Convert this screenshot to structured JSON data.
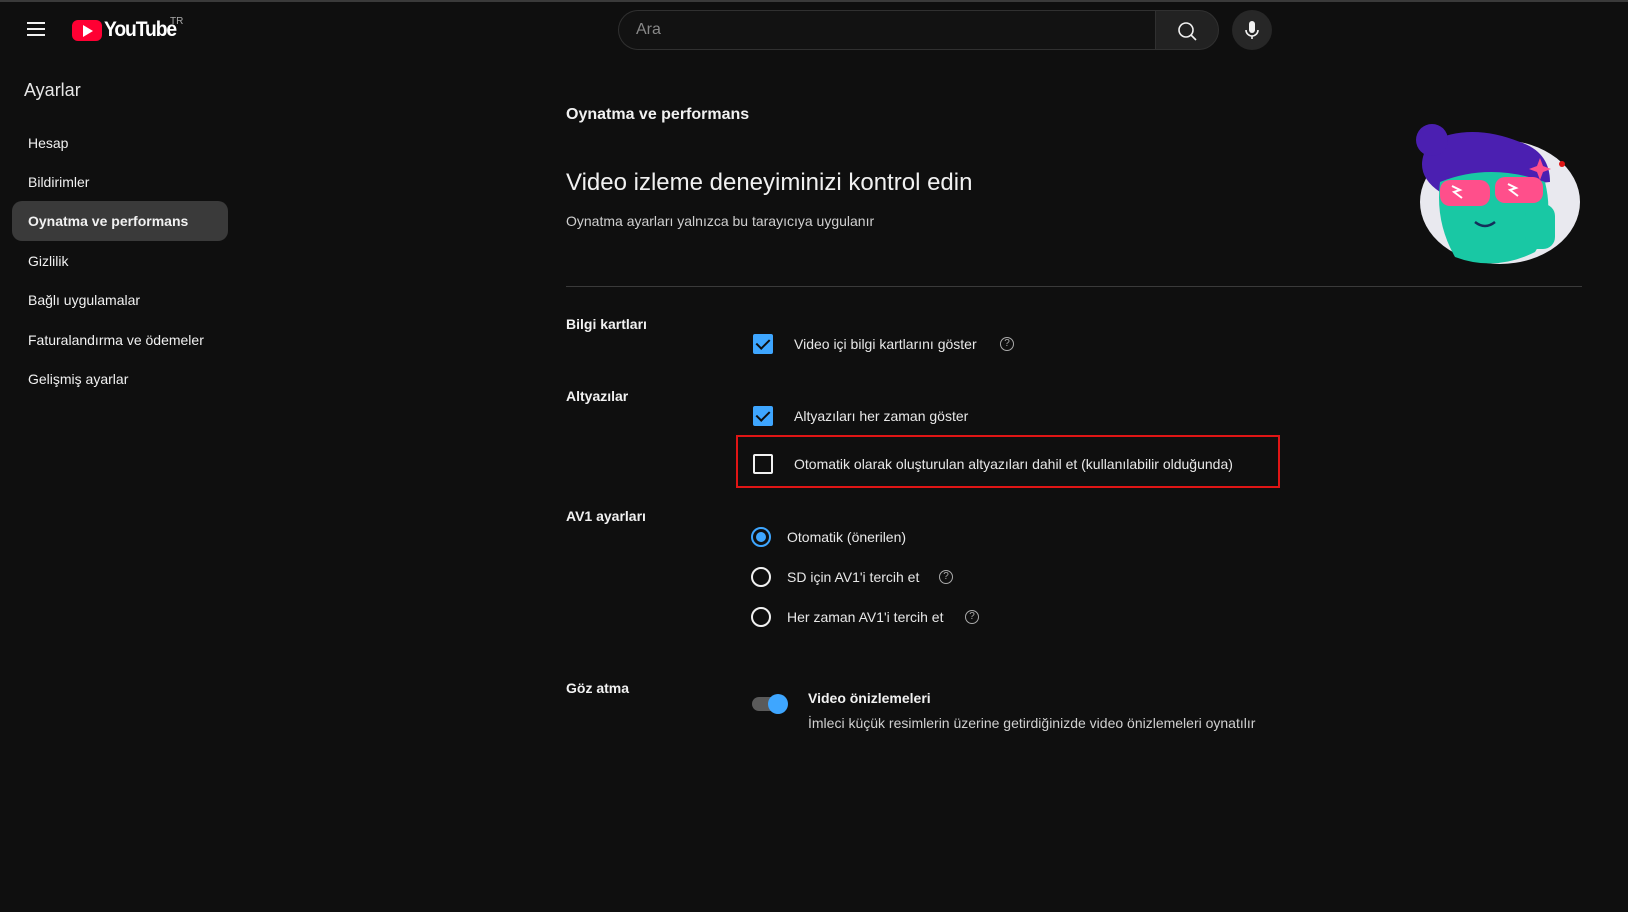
{
  "header": {
    "logo_text": "YouTube",
    "country_code": "TR",
    "search_placeholder": "Ara"
  },
  "sidebar": {
    "title": "Ayarlar",
    "items": [
      {
        "label": "Hesap",
        "active": false
      },
      {
        "label": "Bildirimler",
        "active": false
      },
      {
        "label": "Oynatma ve performans",
        "active": true
      },
      {
        "label": "Gizlilik",
        "active": false
      },
      {
        "label": "Bağlı uygulamalar",
        "active": false
      },
      {
        "label": "Faturalandırma ve ödemeler",
        "active": false
      },
      {
        "label": "Gelişmiş ayarlar",
        "active": false
      }
    ]
  },
  "main": {
    "section_title": "Oynatma ve performans",
    "heading": "Video izleme deneyiminizi kontrol edin",
    "subheading": "Oynatma ayarları yalnızca bu tarayıcıya uygulanır",
    "info_cards": {
      "label": "Bilgi kartları",
      "option": {
        "text": "Video içi bilgi kartlarını göster",
        "checked": true
      }
    },
    "captions": {
      "label": "Altyazılar",
      "options": [
        {
          "text": "Altyazıları her zaman göster",
          "checked": true
        },
        {
          "text": "Otomatik olarak oluşturulan altyazıları dahil et (kullanılabilir olduğunda)",
          "checked": false
        }
      ]
    },
    "av1": {
      "label": "AV1 ayarları",
      "options": [
        {
          "text": "Otomatik (önerilen)",
          "selected": true
        },
        {
          "text": "SD için AV1'i tercih et",
          "selected": false
        },
        {
          "text": "Her zaman AV1'i tercih et",
          "selected": false
        }
      ]
    },
    "peek": {
      "label": "Göz atma",
      "toggle_title": "Video önizlemeleri",
      "toggle_desc": "İmleci küçük resimlerin üzerine getirdiğinizde video önizlemeleri oynatılır",
      "enabled": true
    }
  },
  "colors": {
    "accent": "#3ea6ff",
    "highlight_border": "#e01515",
    "brand_red": "#ff0033"
  }
}
